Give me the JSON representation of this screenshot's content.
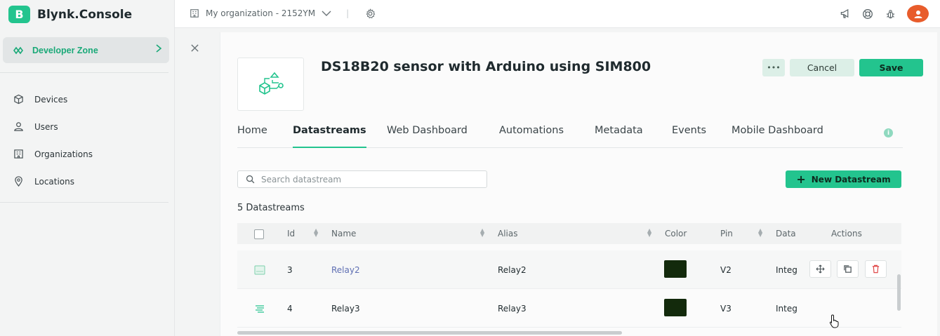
{
  "brand": {
    "logo_letter": "B",
    "name": "Blynk.Console",
    "color": "#23c48e"
  },
  "sidebar": {
    "developer_zone": {
      "label": "Developer Zone",
      "icon": "developer-zone-icon"
    },
    "items": [
      {
        "label": "Devices",
        "icon": "cube-icon"
      },
      {
        "label": "Users",
        "icon": "users-icon"
      },
      {
        "label": "Organizations",
        "icon": "building-icon"
      },
      {
        "label": "Locations",
        "icon": "location-pin-icon"
      }
    ]
  },
  "topbar": {
    "organization": "My organization - 2152YM",
    "icons": [
      "building-icon",
      "gear-icon",
      "megaphone-icon",
      "lifebuoy-icon",
      "bug-icon",
      "avatar-icon"
    ]
  },
  "template": {
    "title": "DS18B20 sensor with Arduino using SIM800",
    "more_label": "•••",
    "cancel_label": "Cancel",
    "save_label": "Save"
  },
  "tabs": [
    {
      "label": "Home",
      "active": false
    },
    {
      "label": "Datastreams",
      "active": true
    },
    {
      "label": "Web Dashboard",
      "active": false
    },
    {
      "label": "Automations",
      "active": false
    },
    {
      "label": "Metadata",
      "active": false
    },
    {
      "label": "Events",
      "active": false
    },
    {
      "label": "Mobile Dashboard",
      "active": false
    }
  ],
  "search": {
    "placeholder": "Search datastream",
    "value": ""
  },
  "new_datastream_label": "New Datastream",
  "count_label": "5 Datastreams",
  "table": {
    "columns": [
      "Id",
      "Name",
      "Alias",
      "Color",
      "Pin",
      "Data",
      "Actions"
    ],
    "rows": [
      {
        "icon": "datastream-type-icon",
        "id": "3",
        "name": "Relay2",
        "alias": "Relay2",
        "color": "#132a0c",
        "pin": "V2",
        "data": "Integ"
      },
      {
        "icon": "datastream-lines-icon",
        "id": "4",
        "name": "Relay3",
        "alias": "Relay3",
        "color": "#132a0c",
        "pin": "V3",
        "data": "Integ"
      }
    ]
  }
}
